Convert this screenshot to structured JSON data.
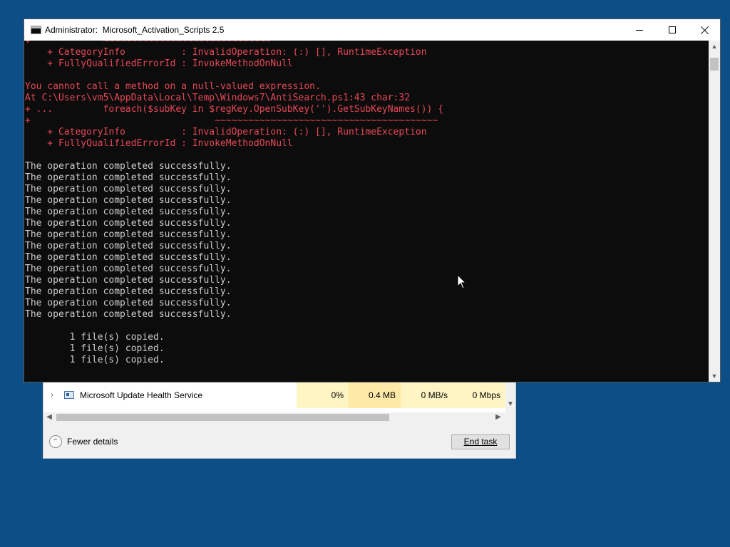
{
  "console": {
    "title_prefix": "Administrator:",
    "title": "Microsoft_Activation_Scripts 2.5",
    "lines": [
      {
        "text": "+             ~~~~~~~~~~~~~~~~~~~~~~~~~~~~~~",
        "err": true
      },
      {
        "text": "    + CategoryInfo          : InvalidOperation: (:) [], RuntimeException",
        "err": true
      },
      {
        "text": "    + FullyQualifiedErrorId : InvokeMethodOnNull",
        "err": true
      },
      {
        "text": "",
        "err": false
      },
      {
        "text": "You cannot call a method on a null-valued expression.",
        "err": true
      },
      {
        "text": "At C:\\Users\\vm5\\AppData\\Local\\Temp\\Windows7\\AntiSearch.ps1:43 char:32",
        "err": true
      },
      {
        "text": "+ ...         foreach($subKey in $regKey.OpenSubKey('').GetSubKeyNames()) {",
        "err": true
      },
      {
        "text": "+                                 ~~~~~~~~~~~~~~~~~~~~~~~~~~~~~~~~~~~~~~~~",
        "err": true
      },
      {
        "text": "    + CategoryInfo          : InvalidOperation: (:) [], RuntimeException",
        "err": true
      },
      {
        "text": "    + FullyQualifiedErrorId : InvokeMethodOnNull",
        "err": true
      },
      {
        "text": "",
        "err": false
      },
      {
        "text": "The operation completed successfully.",
        "err": false
      },
      {
        "text": "The operation completed successfully.",
        "err": false
      },
      {
        "text": "The operation completed successfully.",
        "err": false
      },
      {
        "text": "The operation completed successfully.",
        "err": false
      },
      {
        "text": "The operation completed successfully.",
        "err": false
      },
      {
        "text": "The operation completed successfully.",
        "err": false
      },
      {
        "text": "The operation completed successfully.",
        "err": false
      },
      {
        "text": "The operation completed successfully.",
        "err": false
      },
      {
        "text": "The operation completed successfully.",
        "err": false
      },
      {
        "text": "The operation completed successfully.",
        "err": false
      },
      {
        "text": "The operation completed successfully.",
        "err": false
      },
      {
        "text": "The operation completed successfully.",
        "err": false
      },
      {
        "text": "The operation completed successfully.",
        "err": false
      },
      {
        "text": "The operation completed successfully.",
        "err": false
      },
      {
        "text": "",
        "err": false
      },
      {
        "text": "        1 file(s) copied.",
        "err": false
      },
      {
        "text": "        1 file(s) copied.",
        "err": false
      },
      {
        "text": "        1 file(s) copied.",
        "err": false
      }
    ],
    "colors": {
      "background": "#0c0c0c",
      "text": "#cccccc",
      "error": "#e74856"
    }
  },
  "task_manager": {
    "row": {
      "name": "Microsoft Update Health Service",
      "cpu": "0%",
      "memory": "0.4 MB",
      "disk": "0 MB/s",
      "network": "0 Mbps"
    },
    "fewer_details_label": "Fewer details",
    "end_task_label": "End task"
  },
  "icons": {
    "console_app": "console-icon",
    "service": "service-icon",
    "expand": "chevron-right-icon",
    "collapse": "chevron-up-circle-icon"
  }
}
